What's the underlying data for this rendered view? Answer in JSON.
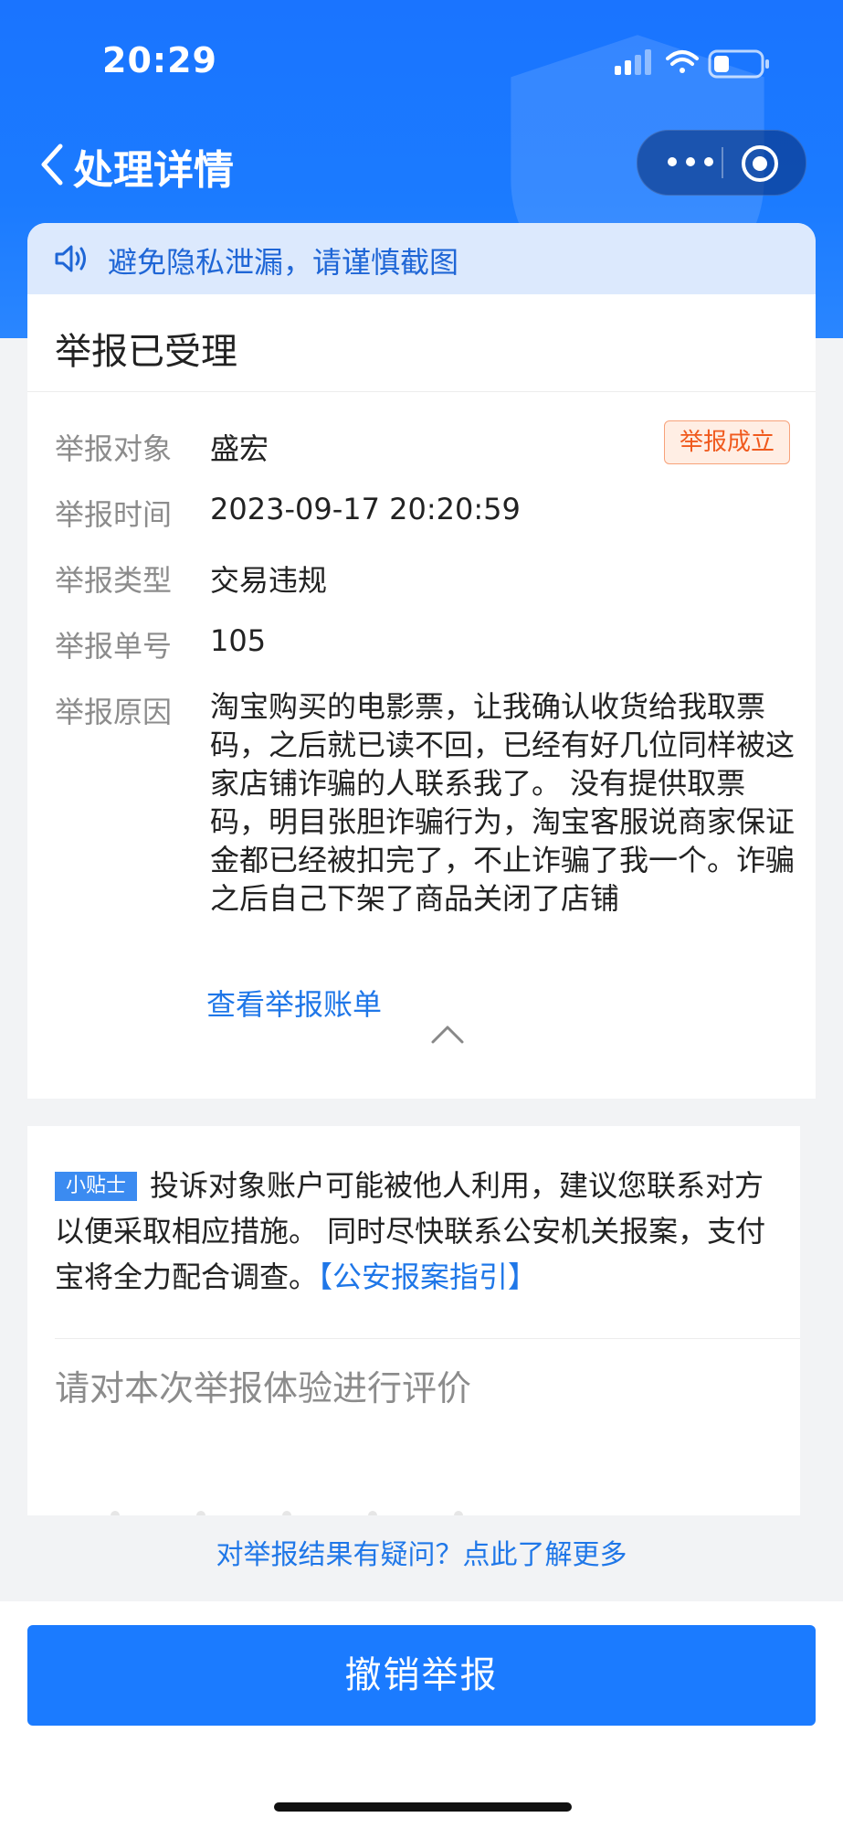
{
  "status_bar": {
    "time": "20:29"
  },
  "nav": {
    "title": "处理详情"
  },
  "notice": {
    "text": "避免隐私泄漏，请谨慎截图"
  },
  "report": {
    "status_title": "举报已受理",
    "badge": "举报成立",
    "rows": [
      {
        "label": "举报对象",
        "value": "盛宏"
      },
      {
        "label": "举报时间",
        "value": "2023-09-17 20:20:59"
      },
      {
        "label": "举报类型",
        "value": "交易违规"
      },
      {
        "label": "举报单号",
        "value": "105"
      },
      {
        "label": "举报原因",
        "value": "淘宝购买的电影票，让我确认收货给我取票码，之后就已读不回，已经有好几位同样被这家店铺诈骗的人联系我了。 没有提供取票码，明目张胆诈骗行为，淘宝客服说商家保证金都已经被扣完了，不止诈骗了我一个。诈骗之后自己下架了商品关闭了店铺"
      }
    ],
    "view_bill_link": "查看举报账单"
  },
  "tip": {
    "tag": "小贴士",
    "text": "投诉对象账户可能被他人利用，建议您联系对方以便采取相应措施。 同时尽快联系公安机关报案，支付宝将全力配合调查。",
    "link": "【公安报案指引】"
  },
  "rating": {
    "title": "请对本次举报体验进行评价"
  },
  "doubt_link": "对举报结果有疑问？点此了解更多",
  "revoke_button": "撤销举报",
  "colors": {
    "brand_blue": "#1b7bff",
    "link_blue": "#1f77e8",
    "badge_orange": "#f05a1e"
  }
}
